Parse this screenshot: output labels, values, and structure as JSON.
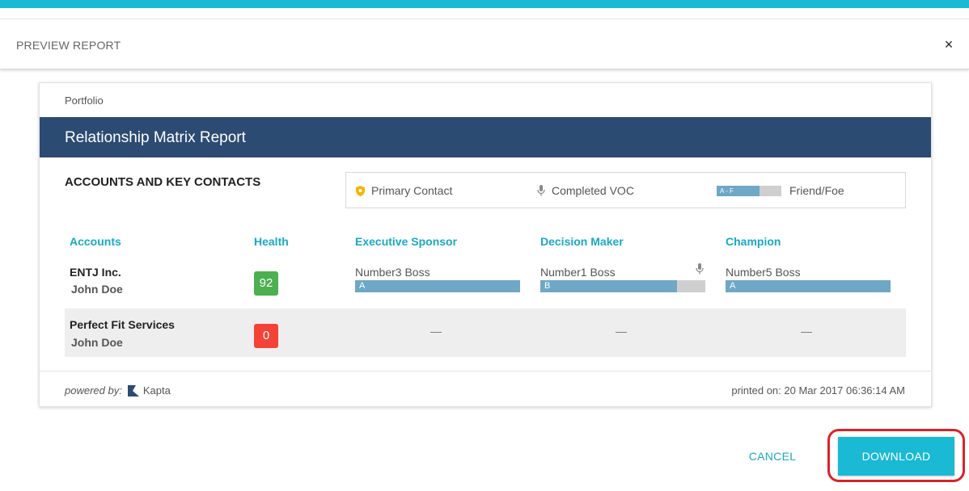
{
  "header": {
    "title": "PREVIEW REPORT",
    "close_glyph": "×"
  },
  "report": {
    "breadcrumb": "Portfolio",
    "title": "Relationship Matrix Report",
    "section_title": "ACCOUNTS AND KEY CONTACTS",
    "legend": {
      "primary_contact": "Primary Contact",
      "completed_voc": "Completed VOC",
      "friend_foe_range": "A - F",
      "friend_foe": "Friend/Foe"
    },
    "columns": [
      "Accounts",
      "Health",
      "Executive Sponsor",
      "Decision Maker",
      "Champion"
    ],
    "rows": [
      {
        "account": "ENTJ Inc.",
        "contact": "John Doe",
        "health": "92",
        "exec": {
          "name": "Number3 Boss",
          "grade": "A",
          "fill": 1.0
        },
        "dm": {
          "name": "Number1 Boss",
          "grade": "B",
          "fill": 0.83,
          "voc": true
        },
        "champ": {
          "name": "Number5 Boss",
          "grade": "A",
          "fill": 1.0
        }
      },
      {
        "account": "Perfect Fit Services",
        "contact": "John Doe",
        "health": "0",
        "empty": "—"
      }
    ],
    "footer": {
      "powered_by": "powered by:",
      "brand": "Kapta",
      "printed_on": "printed on: 20 Mar 2017 06:36:14 AM"
    }
  },
  "actions": {
    "cancel": "CANCEL",
    "download": "DOWNLOAD"
  },
  "colors": {
    "accent": "#1ab9d4",
    "banner": "#2c4b73",
    "health_good": "#4caf50",
    "health_bad": "#f44336",
    "friend_foe_fill": "#6fa7c6",
    "highlight": "#d8232a"
  },
  "icons": [
    "close-icon",
    "shield-icon",
    "microphone-icon",
    "kapta-logo-icon"
  ]
}
